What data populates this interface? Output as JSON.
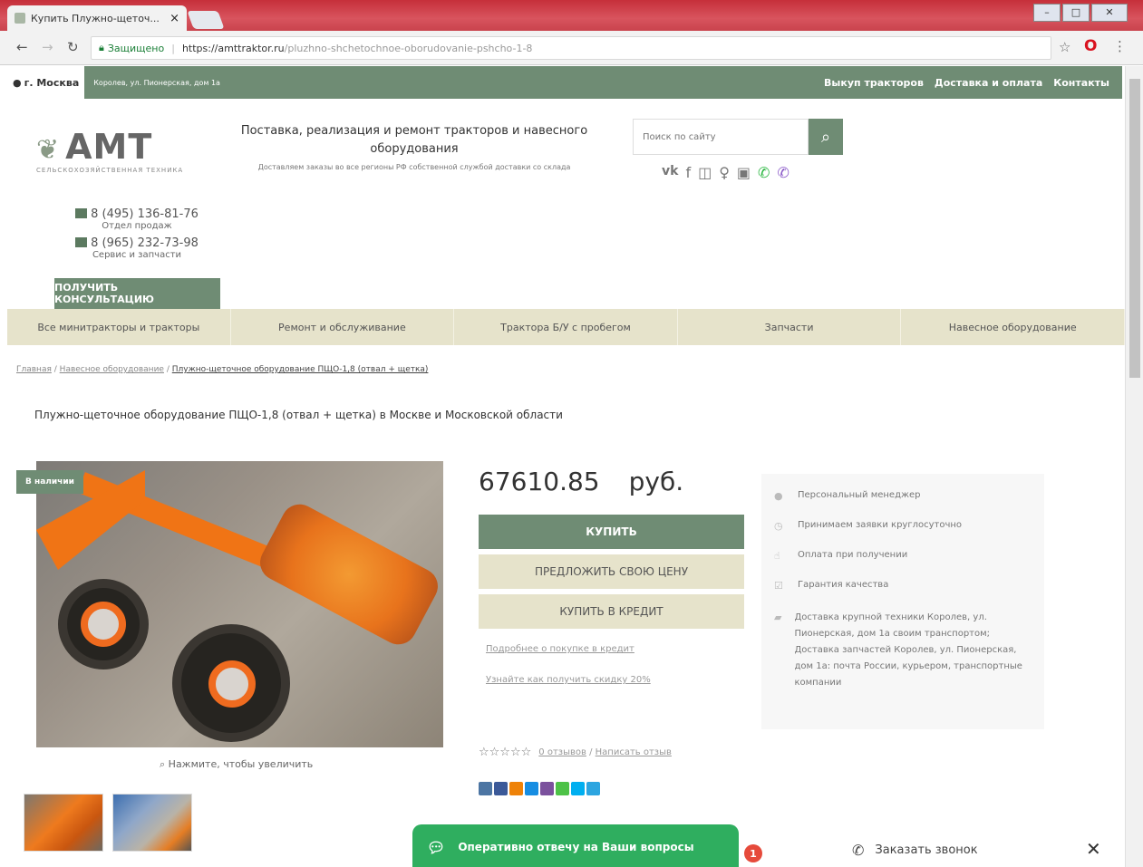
{
  "browser": {
    "tab_title": "Купить Плужно-щеточ...",
    "tab_close": "×",
    "secure_label": "Защищено",
    "url_host": "https://amttraktor.ru",
    "url_path": "/pluzhno-shchetochnoe-oborudovanie-pshcho-1-8"
  },
  "topbar": {
    "city": "г. Москва",
    "address": "Королев, ул. Пионерская, дом 1а",
    "links": [
      "Выкуп тракторов",
      "Доставка и оплата",
      "Контакты"
    ]
  },
  "logo": {
    "name": "АМТ",
    "subtitle": "СЕЛЬСКОХОЗЯЙСТВЕННАЯ ТЕХНИКА"
  },
  "tagline": {
    "title": "Поставка, реализация и ремонт тракторов и навесного оборудования",
    "subtitle": "Доставляем заказы во все регионы РФ собственной службой доставки со склада"
  },
  "search": {
    "placeholder": "Поиск по сайту"
  },
  "contacts": {
    "phone1": "8 (495) 136-81-76",
    "phone1_label": "Отдел продаж",
    "phone2": "8 (965) 232-73-98",
    "phone2_label": "Сервис и запчасти",
    "consult_button": "ПОЛУЧИТЬ КОНСУЛЬТАЦИЮ"
  },
  "menu": [
    "Все минитракторы и тракторы",
    "Ремонт и обслуживание",
    "Трактора Б/У с пробегом",
    "Запчасти",
    "Навесное оборудование"
  ],
  "breadcrumbs": {
    "home": "Главная",
    "sep": "/",
    "section": "Навесное оборудование",
    "current": "Плужно-щеточное оборудование ПЩО-1,8 (отвал + щетка)"
  },
  "page_title": "Плужно-щеточное оборудование ПЩО-1,8 (отвал + щетка) в Москве и Московской области",
  "product": {
    "badge": "В наличии",
    "zoom_hint": "Нажмите, чтобы увеличить",
    "price": "67610.85",
    "currency": "руб.",
    "buy_button": "КУПИТЬ",
    "offer_button": "ПРЕДЛОЖИТЬ СВОЮ ЦЕНУ",
    "credit_button": "КУПИТЬ В КРЕДИТ",
    "credit_link": "Подробнее о покупке в кредит",
    "discount_link": "Узнайте как получить скидку 20%",
    "reviews_link": "0 отзывов",
    "review_sep": "/",
    "write_review_link": "Написать отзыв"
  },
  "features": [
    "Персональный менеджер",
    "Принимаем заявки круглосуточно",
    "Оплата при получении",
    "Гарантия качества",
    "Доставка крупной техники Королев, ул. Пионерская, дом 1а своим транспортом; Доставка запчастей Королев, ул. Пионерская, дом 1а: почта России, курьером, транспортные компании"
  ],
  "chat": {
    "label": "Оперативно отвечу на Ваши вопросы",
    "badge": "1"
  },
  "callback": {
    "label": "Заказать звонок"
  },
  "colors": {
    "accent_green": "#6f8c74",
    "menu_beige": "#e6e3cb",
    "chat_green": "#2fae5f",
    "badge_red": "#e64a3b"
  }
}
